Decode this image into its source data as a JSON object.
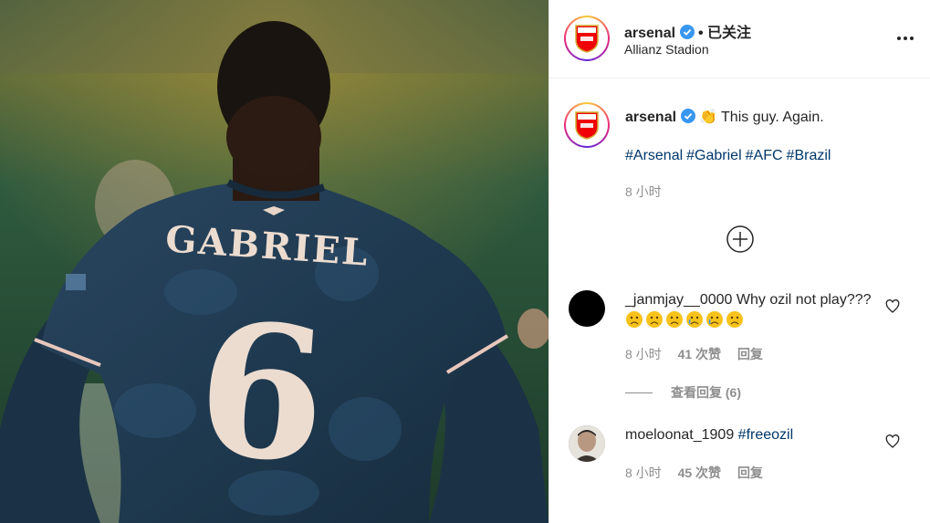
{
  "post": {
    "photo": {
      "jersey_name": "GABRIEL",
      "jersey_number": "6",
      "description_icon": "player-back-photo"
    },
    "header": {
      "username": "arsenal",
      "separator": "•",
      "follow_status": "已关注",
      "location": "Allianz Stadion"
    },
    "caption": {
      "username": "arsenal",
      "emoji": "👏",
      "text": "This guy. Again.",
      "hashtags": [
        "#Arsenal",
        "#Gabriel",
        "#AFC",
        "#Brazil"
      ],
      "time": "8 小时"
    },
    "comments": [
      {
        "username": "_janmjay__0000",
        "text": "Why ozil not play???",
        "emoji_count_visible": 6,
        "time": "8 小时",
        "likes": "41 次赞",
        "reply": "回复",
        "view_replies": "查看回复 (6)"
      },
      {
        "username": "moeloonat_1909",
        "text": "#freeozil",
        "time": "8 小时",
        "likes": "45 次赞",
        "reply": "回复"
      }
    ]
  },
  "colors": {
    "hashtag": "#00376b",
    "muted": "#8e8e8e",
    "verified": "#3897f0",
    "jersey": "#1f3a4d"
  }
}
